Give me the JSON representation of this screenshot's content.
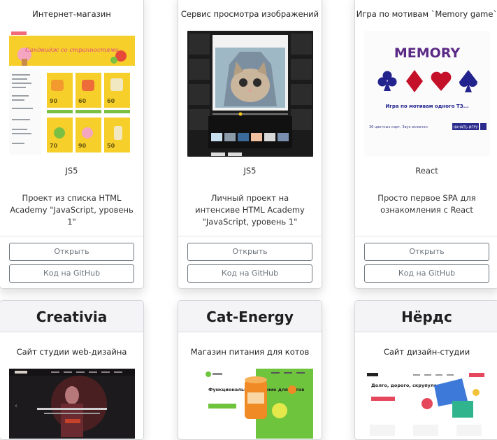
{
  "cards_top": [
    {
      "title": "Интернет-магазин",
      "tech": "JS5",
      "description": "Проект из списка HTML Academy \"JavaScript, уровень 1\"",
      "open_label": "Открыть",
      "github_label": "Код на GitHub",
      "preview": {
        "banner_text": "Сандвидж со странностями",
        "prices": [
          "90",
          "60",
          "60",
          "70",
          "90",
          "50"
        ]
      }
    },
    {
      "title": "Сервис просмотра изображений",
      "tech": "JS5",
      "description": "Личный проект на интенсиве HTML Academy \"JavaScript, уровень 1\"",
      "open_label": "Открыть",
      "github_label": "Код на GitHub"
    },
    {
      "title": "Игра по мотивам `Memory game`",
      "tech": "React",
      "description": "Просто первое SPA для ознакомления с React",
      "open_label": "Открыть",
      "github_label": "Код на GitHub",
      "preview": {
        "heading": "MEMORY",
        "subtitle": "Игра по мотивам одного ТЗ...",
        "footer_left": "36 цветных карт. Звук включен",
        "footer_button": "НАЧАТЬ ИГРУ"
      }
    }
  ],
  "cards_bottom": [
    {
      "title": "Creativia",
      "subtitle": "Сайт студии web-дизайна"
    },
    {
      "title": "Cat-Energy",
      "subtitle": "Магазин питания для котов",
      "preview": {
        "headline": "Функциональное питание для котов"
      }
    },
    {
      "title": "Нёрдс",
      "subtitle": "Сайт дизайн-студии",
      "preview": {
        "headline": "Долго, дорого, скрупулезно."
      }
    }
  ],
  "colors": {
    "card_border": "#d3d6d9",
    "button_border": "#6c757d",
    "memory_purple": "#5b2a86",
    "memory_red": "#c5102a",
    "memory_blue": "#23238e",
    "shop_yellow": "#f7cf2a",
    "catenergy_green": "#6fc43d"
  },
  "icons": [
    "suit-club-icon",
    "suit-diamond-icon",
    "suit-heart-icon",
    "suit-spade-icon"
  ]
}
